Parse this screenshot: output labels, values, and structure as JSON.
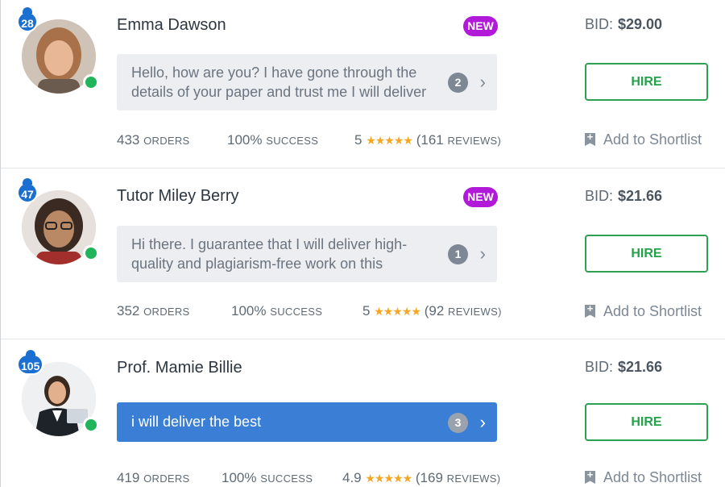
{
  "freelancers": [
    {
      "level": "28",
      "name": "Emma Dawson",
      "new_badge": "NEW",
      "message": "Hello, how are you? I have gone through the details of your paper and trust me I will deliver",
      "message_count": "2",
      "orders": "433",
      "orders_label": "ORDERS",
      "success": "100%",
      "success_label": "SUCCESS",
      "rating": "5",
      "reviews_open": "(161",
      "reviews_label": "REVIEWS)",
      "bid_label": "BID:",
      "bid": "$29.00",
      "hire_label": "HIRE",
      "shortlist_label": "Add to Shortlist"
    },
    {
      "level": "47",
      "name": "Tutor Miley Berry",
      "new_badge": "NEW",
      "message": "Hi there. I guarantee that I will deliver high-quality and plagiarism-free work on this",
      "message_count": "1",
      "orders": "352",
      "orders_label": "ORDERS",
      "success": "100%",
      "success_label": "SUCCESS",
      "rating": "5",
      "reviews_open": "(92",
      "reviews_label": "REVIEWS)",
      "bid_label": "BID:",
      "bid": "$21.66",
      "hire_label": "HIRE",
      "shortlist_label": "Add to Shortlist"
    },
    {
      "level": "105",
      "name": "Prof. Mamie Billie",
      "message": "i will deliver the best",
      "message_count": "3",
      "orders": "419",
      "orders_label": "ORDERS",
      "success": "100%",
      "success_label": "SUCCESS",
      "rating": "4.9",
      "reviews_open": "(169",
      "reviews_label": "REVIEWS)",
      "bid_label": "BID:",
      "bid": "$21.66",
      "hire_label": "HIRE",
      "shortlist_label": "Add to Shortlist"
    }
  ],
  "stars_glyph": "★★★★★",
  "chevron_glyph": "›",
  "colors": {
    "level_badge": "#1a6fd0",
    "new_badge": "#b11ad8",
    "online": "#21b45b",
    "hire": "#2da051",
    "active_message": "#3a7fd5",
    "stars": "#f5a623"
  }
}
